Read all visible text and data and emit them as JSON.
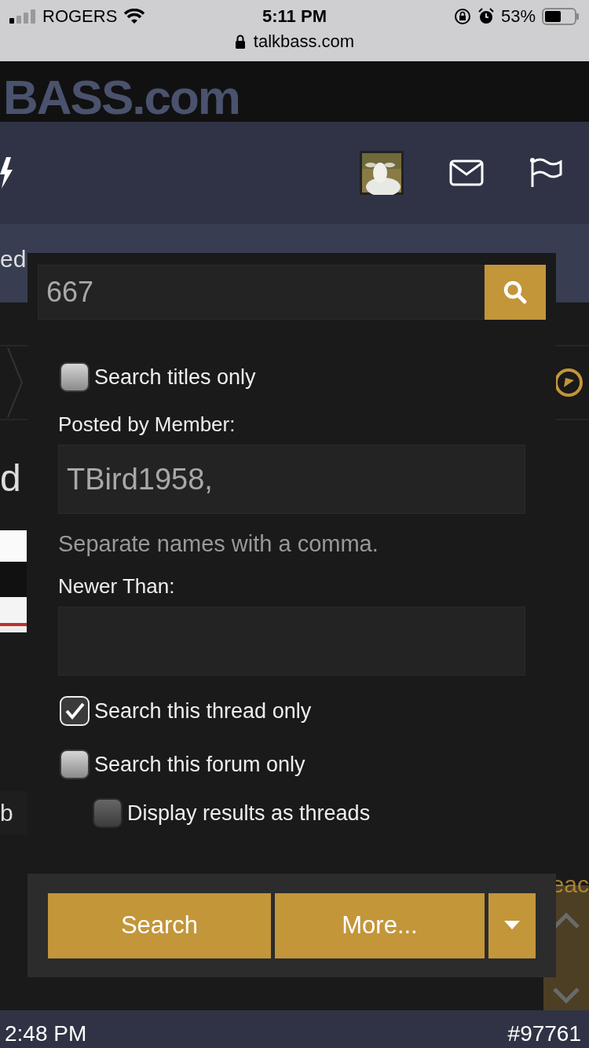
{
  "status_bar": {
    "carrier": "ROGERS",
    "time": "5:11 PM",
    "battery": "53%",
    "url": "talkbass.com"
  },
  "site": {
    "logo": "BASS.com",
    "nav_fragment": "ed",
    "heading_fragment": "d",
    "row_fragment": "b",
    "side_link_fragment": "eac",
    "post_time": "2:48 PM",
    "post_number": "#97761"
  },
  "search": {
    "query": "667",
    "options": [
      {
        "label": "Search titles only",
        "checked": false
      }
    ],
    "member_label": "Posted by Member:",
    "member_value": "TBird1958,",
    "member_hint": "Separate names with a comma.",
    "newer_label": "Newer Than:",
    "scope": [
      {
        "label": "Search this thread only",
        "checked": true
      },
      {
        "label": "Search this forum only",
        "checked": false,
        "children": [
          {
            "label": "Display results as threads",
            "checked": false
          }
        ]
      }
    ],
    "buttons": [
      "Search",
      "More..."
    ]
  }
}
